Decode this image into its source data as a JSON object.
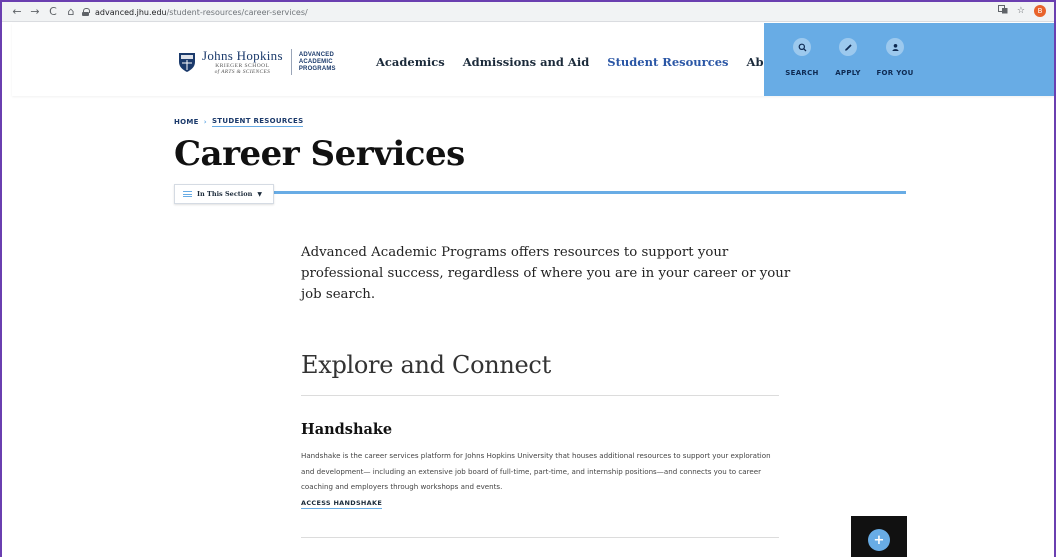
{
  "browser": {
    "back_icon": "←",
    "forward_icon": "→",
    "reload_icon": "C",
    "home_icon": "⌂",
    "url_domain": "advanced.jhu.edu",
    "url_path": "/student-resources/career-services/",
    "profile_initial": "B"
  },
  "header": {
    "logo_name": "Johns Hopkins",
    "logo_sub1": "KRIEGER SCHOOL",
    "logo_sub2": "of ARTS & SCIENCES",
    "aap_line1": "ADVANCED",
    "aap_line2": "ACADEMIC",
    "aap_line3": "PROGRAMS",
    "nav": [
      {
        "label": "Academics"
      },
      {
        "label": "Admissions and Aid"
      },
      {
        "label": "Student Resources"
      },
      {
        "label": "About"
      }
    ],
    "utility": {
      "search": "SEARCH",
      "apply": "APPLY",
      "for_you": "FOR YOU"
    },
    "colors": {
      "accent": "#68ace5",
      "navy": "#1b3a6b",
      "active_nav": "#2a56a5"
    }
  },
  "breadcrumb": {
    "home": "HOME",
    "separator": "›",
    "current": "STUDENT RESOURCES"
  },
  "page": {
    "title": "Career Services",
    "in_section": "In This Section",
    "intro": "Advanced Academic Programs offers resources to support your professional success, regardless of where you are in your career or your job search.",
    "explore_heading": "Explore and Connect"
  },
  "handshake": {
    "heading": "Handshake",
    "body": "Handshake is the career services platform for Johns Hopkins University that houses additional resources to support your exploration and development— including an extensive job board of full-time, part-time, and internship positions—and connects you to career coaching and employers through workshops and events.",
    "link": "ACCESS HANDSHAKE"
  },
  "fab": {
    "icon": "+"
  }
}
